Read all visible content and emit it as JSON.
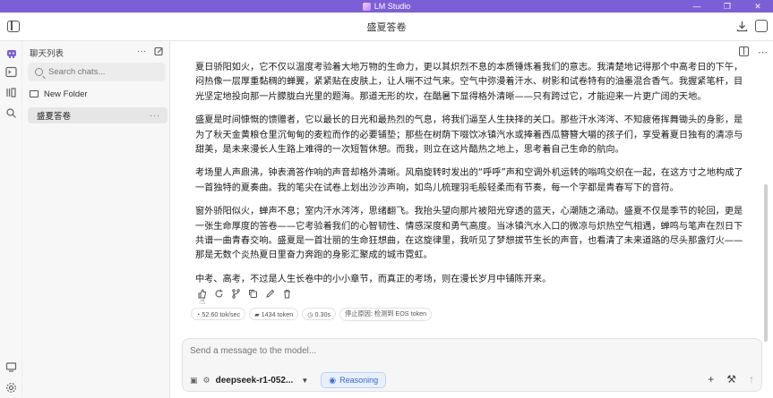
{
  "window": {
    "app_title": "LM Studio",
    "controls": [
      "—",
      "❐",
      "✕"
    ]
  },
  "header": {
    "chat_title": "盛夏答卷"
  },
  "rail": {
    "icons": [
      "chat-icon",
      "terminal-icon",
      "folder-icon",
      "search-models-icon"
    ],
    "bottom_icons": [
      "download-icon",
      "settings-icon"
    ]
  },
  "sidebar": {
    "label": "聊天列表",
    "search_placeholder": "Search chats...",
    "folder_label": "New Folder",
    "chats": [
      {
        "title": "盛夏答卷",
        "more": "···"
      }
    ]
  },
  "message": {
    "paragraphs": [
      "夏日骄阳如火，它不仅以温度考验着大地万物的生命力，更以其炽烈不息的本质锤炼着我们的意志。我清楚地记得那个中高考日的下午，闷热像一层厚重黏稠的蝉翼，紧紧贴在皮肤上，让人喘不过气来。空气中弥漫着汗水、树影和试卷特有的油墨混合香气。我握紧笔杆，目光坚定地投向那一片朦胧白光里的题海。那道无形的坎，在酷暑下显得格外清晰——只有跨过它，才能迎来一片更广阔的天地。",
      "盛夏是时间慷慨的馈赠者，它以最长的日光和最热烈的气息，将我们逼至人生抉择的关口。那些汗水涔涔、不知疲倦挥舞锄头的身影，是为了秋天金黄粮仓里沉甸甸的麦粒而作的必要铺垫；那些在树荫下啜饮冰镇汽水或捧着西瓜簪簪大嚼的孩子们，享受着夏日独有的清凉与甜美，是未来漫长人生路上难得的一次短暂休憩。而我，则立在这片酷热之地上，思考着自己生命的航向。",
      "考场里人声鼎沸，钟表滴答作响的声音却格外清晰。风扇旋转时发出的“呼呼”声和空调外机运转的嗡鸣交织在一起，在这方寸之地构成了一首独特的夏奏曲。我的笔尖在试卷上划出沙沙声响，如鸟儿梳理羽毛般轻柔而有节奏，每一个字都是青春写下的音符。",
      "窗外骄阳似火，蝉声不息；室内汗水涔涔，思绪翻飞。我抬头望向那片被阳光穿透的蓝天，心潮随之涌动。盛夏不仅是季节的轮回，更是一张生命厚度的答卷——它考验着我们的心智韧性、情感深度和勇气高度。当冰镇汽水入口的微凉与炽热空气相遇，蝉鸣与笔声在烈日下共谱一曲青春交响。盛夏是一首壮丽的生命狂想曲，在这旋律里，我听见了梦想拔节生长的声音，也看清了未来道路的尽头那盏灯火——那是无数个炎热夏日里奋力奔跑的身影汇聚成的城市霓虹。",
      "中考、高考，不过是人生长卷中的小小章节，而真正的考场，则在漫长岁月中铺陈开来。"
    ]
  },
  "message_actions": [
    "like-icon",
    "regenerate-icon",
    "branch-icon",
    "copy-icon",
    "edit-icon",
    "delete-icon"
  ],
  "stats": {
    "speed": "52.60 tok/sec",
    "tokens": "1434 token",
    "time": "0.30s",
    "stop_reason": "停止原因: 检测到 EOS token"
  },
  "composer": {
    "placeholder": "Send a message to the model...",
    "model": "deepseek-r1-052...",
    "reasoning_label": "Reasoning",
    "add_label": "+",
    "tools_label": "⚒",
    "send_label": "↑"
  }
}
